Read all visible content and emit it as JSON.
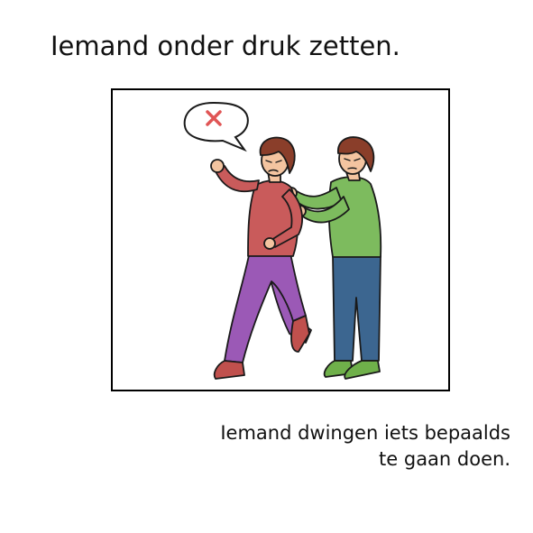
{
  "title": "Iemand onder druk zetten.",
  "caption": {
    "line1": "Iemand dwingen iets bepaalds",
    "line2": "te gaan doen."
  },
  "illustration": {
    "speech_bubble_icon": "x-mark-icon",
    "colors": {
      "outline": "#1a1a1a",
      "red_shirt": "#c95b5b",
      "purple_pants": "#9b59b6",
      "red_shoes": "#c0504d",
      "green_shirt": "#7dbb5e",
      "blue_pants": "#3c6690",
      "green_shoes": "#6fb04a",
      "skin": "#f3c4a0",
      "hair": "#8a3e2a",
      "x_mark": "#e05555"
    }
  }
}
